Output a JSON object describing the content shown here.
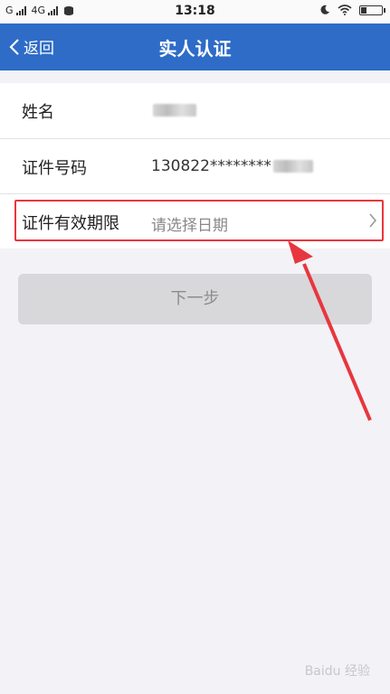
{
  "status_bar": {
    "carrier1": "G",
    "carrier2": "4G",
    "time": "13:18"
  },
  "nav": {
    "back_label": "返回",
    "title": "实人认证"
  },
  "form": {
    "name_label": "姓名",
    "id_label": "证件号码",
    "id_value": "130822********",
    "validity_label": "证件有效期限",
    "validity_placeholder": "请选择日期"
  },
  "actions": {
    "next_label": "下一步"
  },
  "colors": {
    "nav_bg": "#2e6cc7",
    "highlight": "#e8363e",
    "button_disabled": "#d8d8da"
  },
  "watermark": "Baidu 经验"
}
